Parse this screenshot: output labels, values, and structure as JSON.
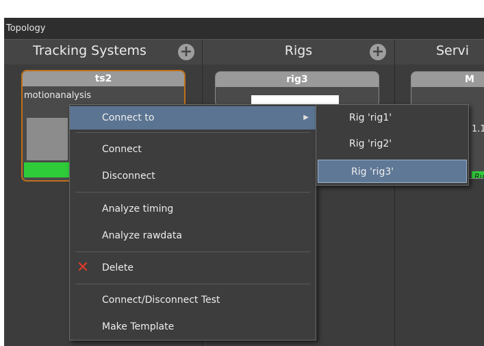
{
  "topology": {
    "title": "Topology"
  },
  "columns": [
    {
      "title": "Tracking Systems",
      "add_icon": "plus-icon"
    },
    {
      "title": "Rigs",
      "add_icon": "plus-icon"
    },
    {
      "title": "Servi"
    }
  ],
  "cards": {
    "tracking_system": {
      "title": "ts2",
      "text": "motionanalysis"
    },
    "rig": {
      "title": "rig3"
    },
    "service": {
      "title": "M",
      "line1": "1.1",
      "badge": "Ru"
    }
  },
  "context_menu": {
    "items": [
      {
        "label": "Connect to",
        "has_submenu": true
      },
      {
        "label": "Connect"
      },
      {
        "label": "Disconnect"
      },
      {
        "label": "Analyze timing"
      },
      {
        "label": "Analyze rawdata"
      },
      {
        "label": "Delete",
        "icon": "delete-x-icon"
      },
      {
        "label": "Connect/Disconnect Test"
      },
      {
        "label": "Make Template"
      }
    ],
    "submenu_arrow": "▶",
    "delete_glyph": "✕"
  },
  "submenu": {
    "items": [
      {
        "label": "Rig 'rig1'"
      },
      {
        "label": "Rig 'rig2'"
      },
      {
        "label": "Rig 'rig3'"
      }
    ]
  },
  "colors": {
    "selection_border": "#c07018",
    "status_green": "#2fcc3a",
    "menu_highlight": "#5b7492",
    "delete_red": "#e23b2a"
  }
}
